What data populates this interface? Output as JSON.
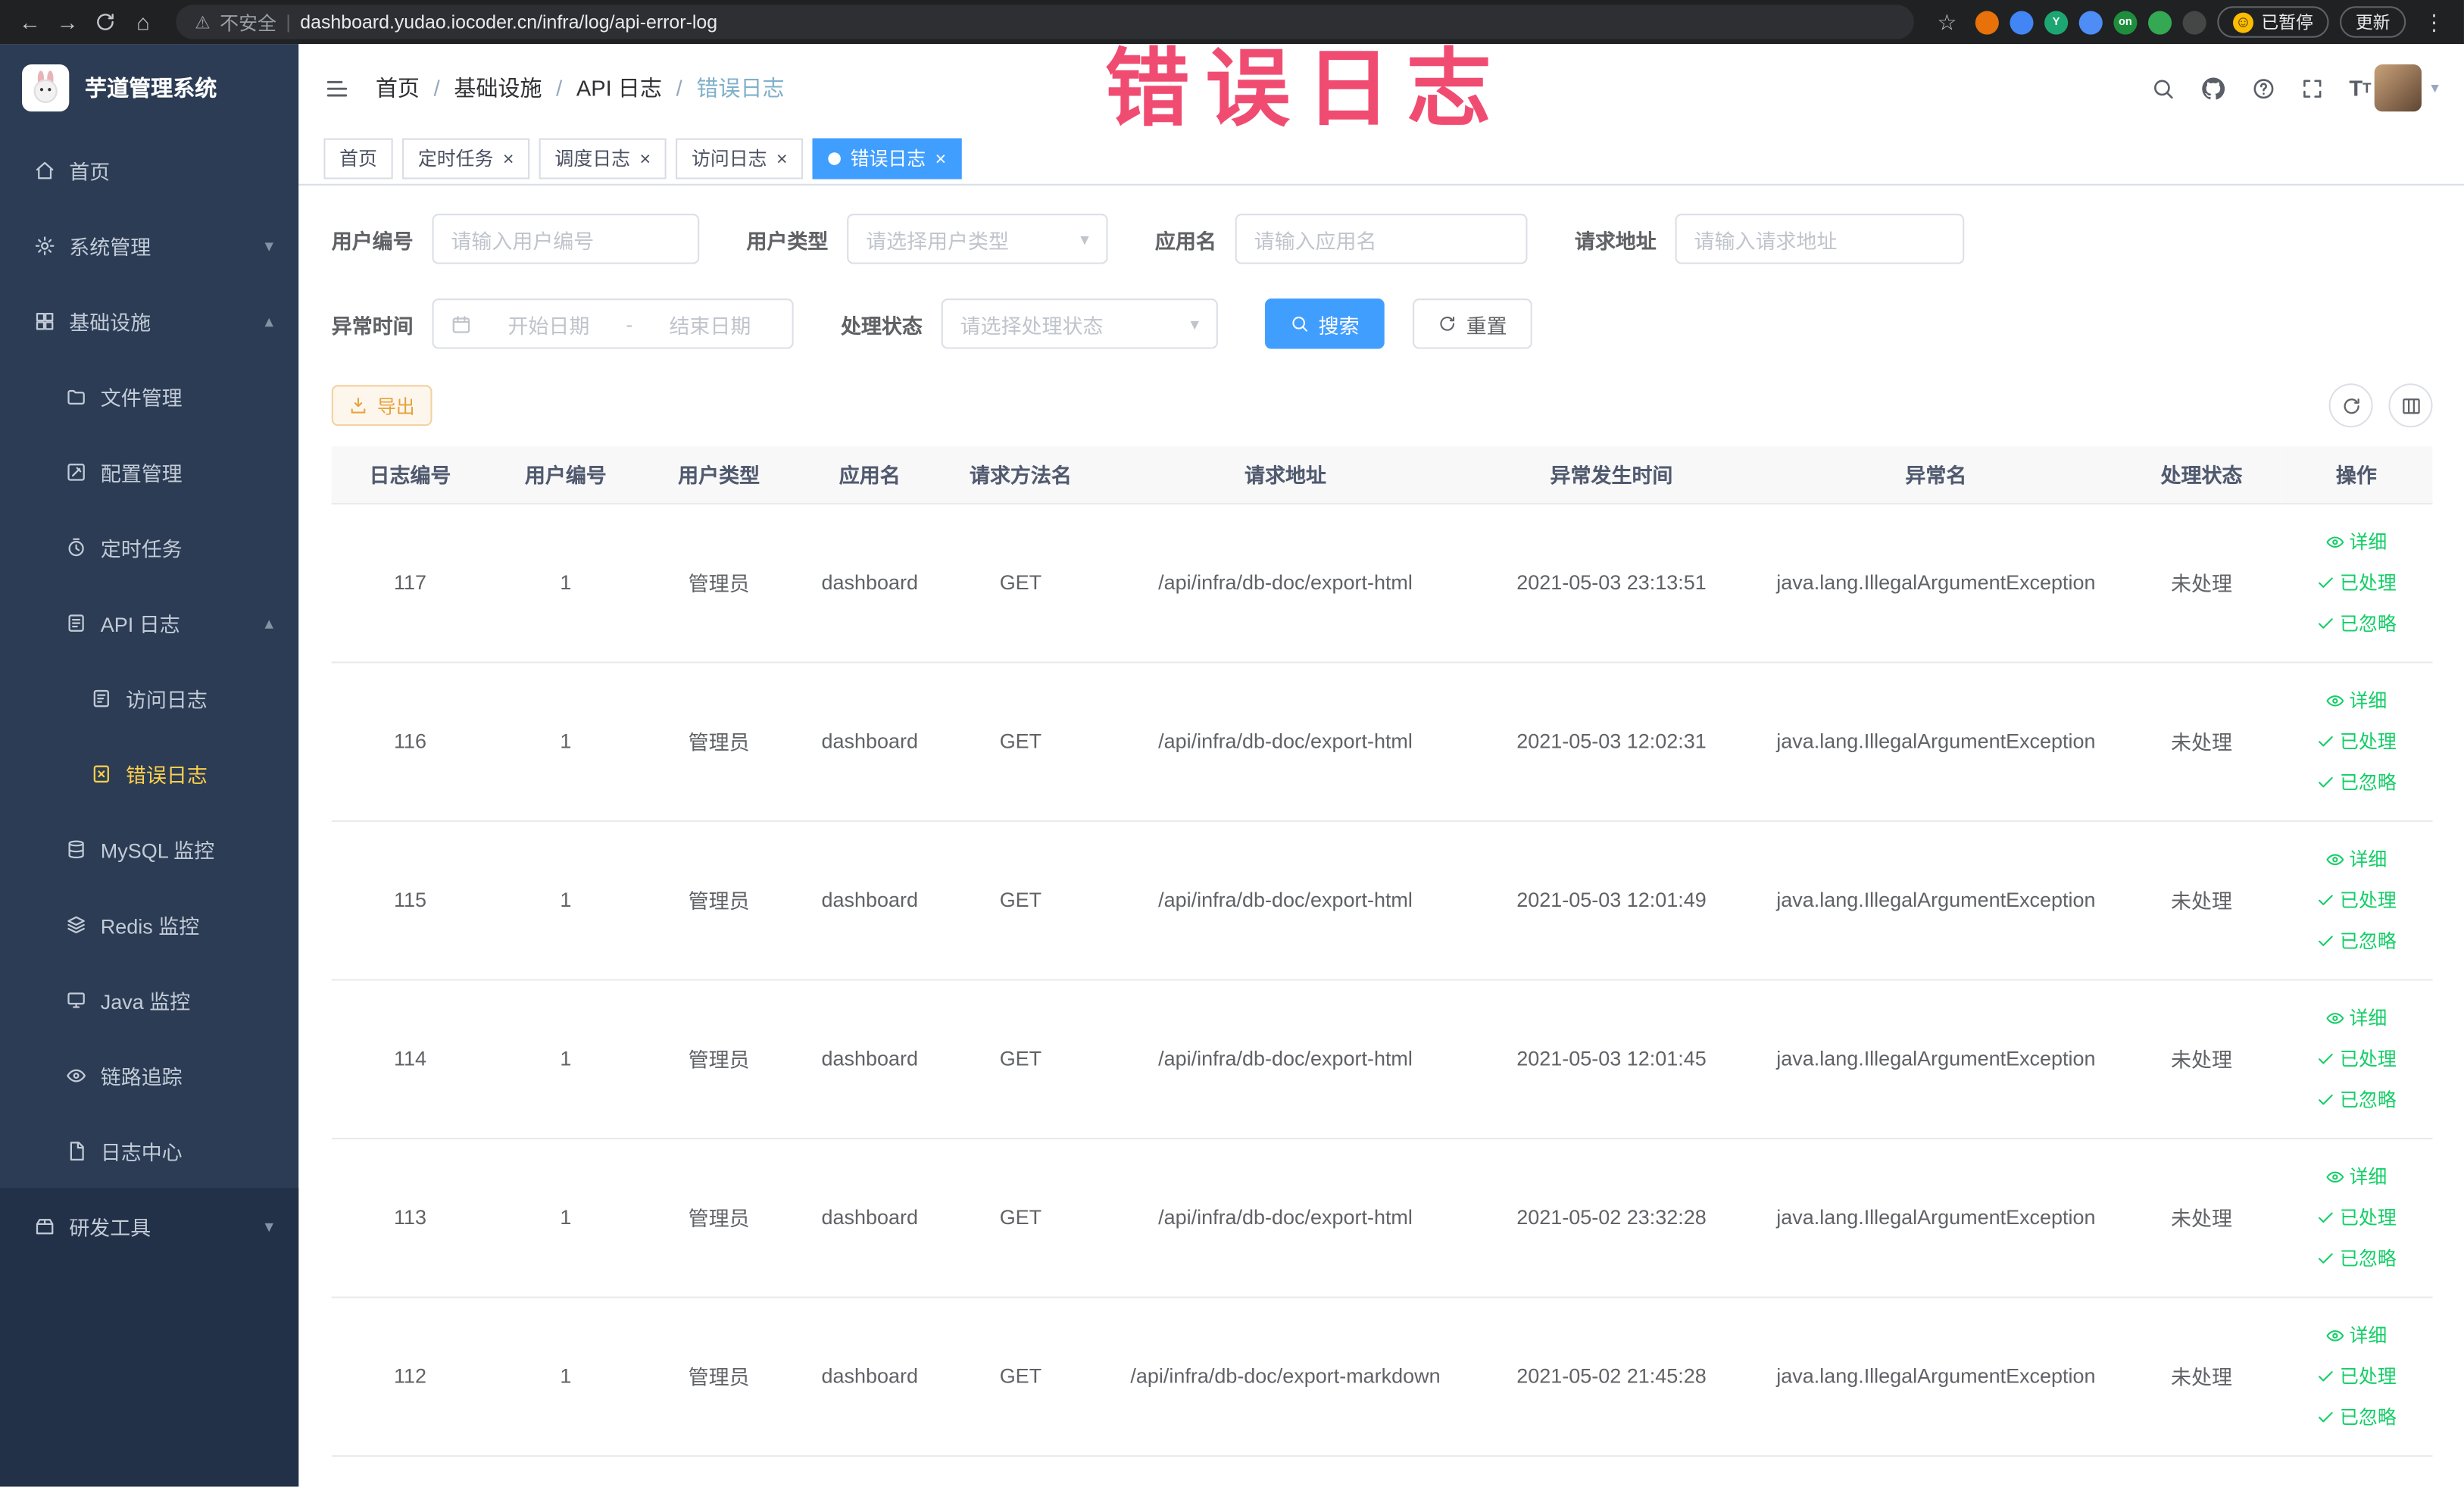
{
  "browser": {
    "security_label": "不安全",
    "url": "dashboard.yudao.iocoder.cn/infra/log/api-error-log",
    "paused_badge": "已暂停",
    "update_label": "更新",
    "extensions": [
      {
        "color": "#e8710a",
        "label": ""
      },
      {
        "color": "#4285f4",
        "label": ""
      },
      {
        "color": "#1ea672",
        "label": "Y"
      },
      {
        "color": "#4e8df5",
        "label": ""
      },
      {
        "color": "#1e8e3e",
        "label": "on"
      },
      {
        "color": "#34a853",
        "label": ""
      },
      {
        "color": "#444746",
        "label": ""
      }
    ]
  },
  "annotation": {
    "text": "错误日志",
    "color": "#f0436b"
  },
  "sidebar": {
    "logo_title": "芋道管理系统",
    "items": [
      {
        "label": "首页",
        "icon": "home-icon",
        "level": 1
      },
      {
        "label": "系统管理",
        "icon": "gear-icon",
        "level": 1,
        "chevron": "down"
      },
      {
        "label": "基础设施",
        "icon": "infra-icon",
        "level": 1,
        "chevron": "up"
      },
      {
        "label": "文件管理",
        "icon": "file-icon",
        "level": 2
      },
      {
        "label": "配置管理",
        "icon": "config-icon",
        "level": 2
      },
      {
        "label": "定时任务",
        "icon": "timer-icon",
        "level": 2
      },
      {
        "label": "API 日志",
        "icon": "api-log-icon",
        "level": 2,
        "chevron": "up"
      },
      {
        "label": "访问日志",
        "icon": "access-log-icon",
        "level": 3
      },
      {
        "label": "错误日志",
        "icon": "error-log-icon",
        "level": 3,
        "active": true
      },
      {
        "label": "MySQL 监控",
        "icon": "mysql-icon",
        "level": 2
      },
      {
        "label": "Redis 监控",
        "icon": "redis-icon",
        "level": 2
      },
      {
        "label": "Java 监控",
        "icon": "java-icon",
        "level": 2
      },
      {
        "label": "链路追踪",
        "icon": "trace-icon",
        "level": 2
      },
      {
        "label": "日志中心",
        "icon": "log-center-icon",
        "level": 2
      }
    ],
    "bottom_items": [
      {
        "label": "研发工具",
        "icon": "devtools-icon",
        "level": 1,
        "chevron": "down"
      }
    ]
  },
  "breadcrumb": {
    "items": [
      "首页",
      "基础设施",
      "API 日志",
      "错误日志"
    ]
  },
  "header_icons": [
    "search-icon",
    "github-icon",
    "help-icon",
    "fullscreen-icon",
    "fontsize-icon"
  ],
  "tabs": [
    {
      "label": "首页",
      "closable": false,
      "active": false
    },
    {
      "label": "定时任务",
      "closable": true,
      "active": false
    },
    {
      "label": "调度日志",
      "closable": true,
      "active": false
    },
    {
      "label": "访问日志",
      "closable": true,
      "active": false
    },
    {
      "label": "错误日志",
      "closable": true,
      "active": true
    }
  ],
  "filters": {
    "user_id": {
      "label": "用户编号",
      "placeholder": "请输入用户编号"
    },
    "user_type": {
      "label": "用户类型",
      "placeholder": "请选择用户类型"
    },
    "app_name": {
      "label": "应用名",
      "placeholder": "请输入应用名"
    },
    "request_url": {
      "label": "请求地址",
      "placeholder": "请输入请求地址"
    },
    "exception_time": {
      "label": "异常时间",
      "start_placeholder": "开始日期",
      "separator": "-",
      "end_placeholder": "结束日期"
    },
    "process_status": {
      "label": "处理状态",
      "placeholder": "请选择处理状态"
    },
    "search_label": "搜索",
    "reset_label": "重置"
  },
  "toolbar": {
    "export_label": "导出"
  },
  "table": {
    "columns": [
      "日志编号",
      "用户编号",
      "用户类型",
      "应用名",
      "请求方法名",
      "请求地址",
      "异常发生时间",
      "异常名",
      "处理状态",
      "操作"
    ],
    "actions": {
      "detail": "详细",
      "processed": "已处理",
      "ignored": "已忽略"
    },
    "rows": [
      {
        "id": "117",
        "user_id": "1",
        "user_type": "管理员",
        "app": "dashboard",
        "method": "GET",
        "url": "/api/infra/db-doc/export-html",
        "time": "2021-05-03 23:13:51",
        "exception": "java.lang.IllegalArgumentException",
        "status": "未处理"
      },
      {
        "id": "116",
        "user_id": "1",
        "user_type": "管理员",
        "app": "dashboard",
        "method": "GET",
        "url": "/api/infra/db-doc/export-html",
        "time": "2021-05-03 12:02:31",
        "exception": "java.lang.IllegalArgumentException",
        "status": "未处理"
      },
      {
        "id": "115",
        "user_id": "1",
        "user_type": "管理员",
        "app": "dashboard",
        "method": "GET",
        "url": "/api/infra/db-doc/export-html",
        "time": "2021-05-03 12:01:49",
        "exception": "java.lang.IllegalArgumentException",
        "status": "未处理"
      },
      {
        "id": "114",
        "user_id": "1",
        "user_type": "管理员",
        "app": "dashboard",
        "method": "GET",
        "url": "/api/infra/db-doc/export-html",
        "time": "2021-05-03 12:01:45",
        "exception": "java.lang.IllegalArgumentException",
        "status": "未处理"
      },
      {
        "id": "113",
        "user_id": "1",
        "user_type": "管理员",
        "app": "dashboard",
        "method": "GET",
        "url": "/api/infra/db-doc/export-html",
        "time": "2021-05-02 23:32:28",
        "exception": "java.lang.IllegalArgumentException",
        "status": "未处理"
      },
      {
        "id": "112",
        "user_id": "1",
        "user_type": "管理员",
        "app": "dashboard",
        "method": "GET",
        "url": "/api/infra/db-doc/export-markdown",
        "time": "2021-05-02 21:45:28",
        "exception": "java.lang.IllegalArgumentException",
        "status": "未处理"
      }
    ]
  }
}
